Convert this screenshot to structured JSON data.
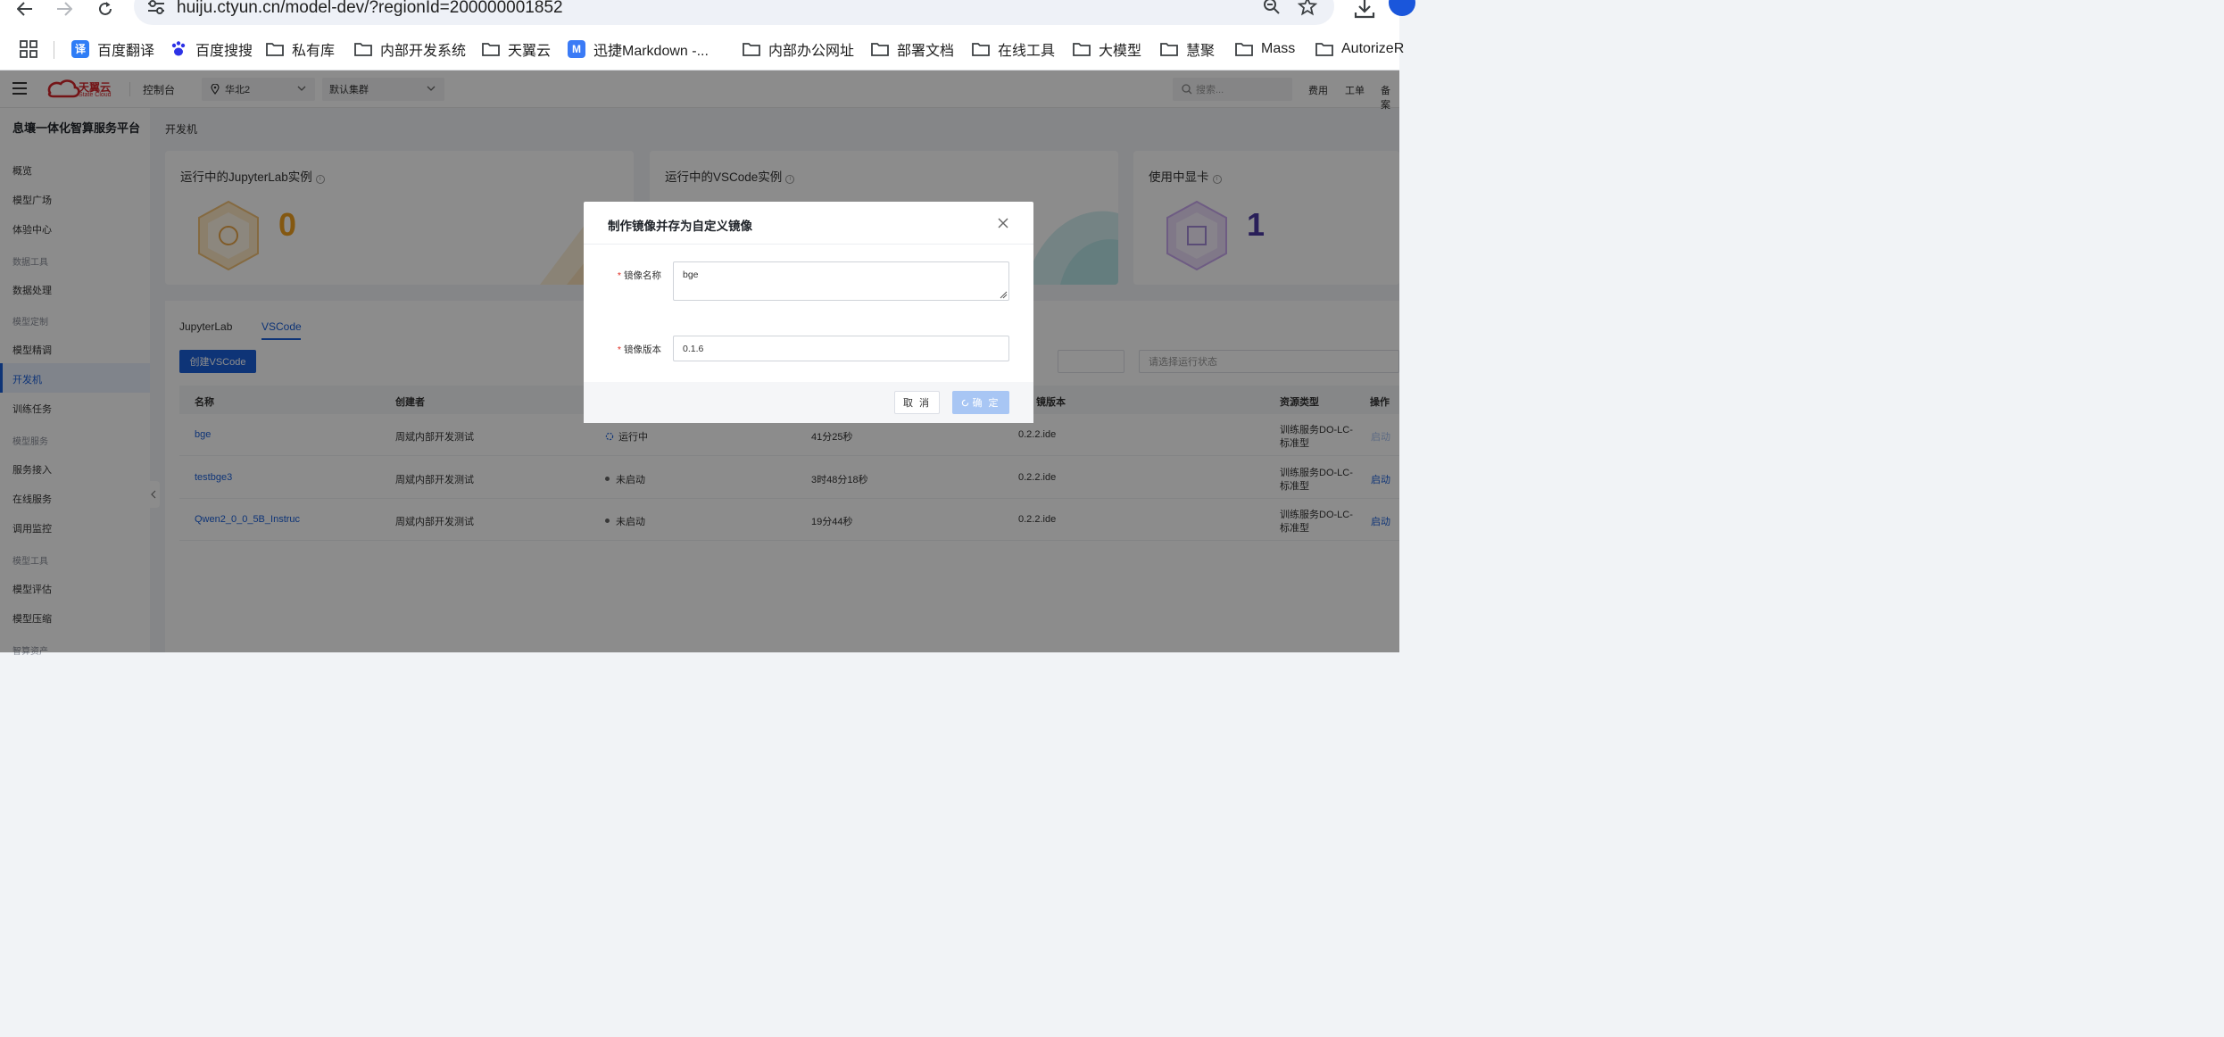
{
  "browser": {
    "url": "huiju.ctyun.cn/model-dev/?regionId=200000001852",
    "bookmarks": [
      {
        "label": "百度翻译",
        "icon": "translate-icon"
      },
      {
        "label": "百度搜搜",
        "icon": "baidu-paw-icon"
      },
      {
        "label": "私有库",
        "icon": "folder-icon"
      },
      {
        "label": "内部开发系统",
        "icon": "folder-icon"
      },
      {
        "label": "天翼云",
        "icon": "folder-icon"
      },
      {
        "label": "迅捷Markdown -...",
        "icon": "markdown-app-icon"
      },
      {
        "label": "内部办公网址",
        "icon": "folder-icon"
      },
      {
        "label": "部署文档",
        "icon": "folder-icon"
      },
      {
        "label": "在线工具",
        "icon": "folder-icon"
      },
      {
        "label": "大模型",
        "icon": "folder-icon"
      },
      {
        "label": "慧聚",
        "icon": "folder-icon"
      },
      {
        "label": "Mass",
        "icon": "folder-icon"
      },
      {
        "label": "AutorizeR",
        "icon": "folder-icon"
      }
    ]
  },
  "topnav": {
    "logo_cn": "天翼云",
    "logo_en": "State Cloud",
    "console": "控制台",
    "region": "华北2",
    "cluster": "默认集群",
    "search_placeholder": "搜索...",
    "links": [
      "费用",
      "工单",
      "备案"
    ]
  },
  "sidebar": {
    "title": "息壤一体化智算服务平台",
    "items": [
      {
        "type": "item",
        "label": "概览"
      },
      {
        "type": "item",
        "label": "模型广场"
      },
      {
        "type": "item",
        "label": "体验中心"
      },
      {
        "type": "group",
        "label": "数据工具"
      },
      {
        "type": "item",
        "label": "数据处理"
      },
      {
        "type": "group",
        "label": "模型定制"
      },
      {
        "type": "item",
        "label": "模型精调"
      },
      {
        "type": "active",
        "label": "开发机"
      },
      {
        "type": "item",
        "label": "训练任务"
      },
      {
        "type": "group",
        "label": "模型服务"
      },
      {
        "type": "item",
        "label": "服务接入"
      },
      {
        "type": "item",
        "label": "在线服务"
      },
      {
        "type": "item",
        "label": "调用监控"
      },
      {
        "type": "group",
        "label": "模型工具"
      },
      {
        "type": "item",
        "label": "模型评估"
      },
      {
        "type": "item",
        "label": "模型压缩"
      },
      {
        "type": "group",
        "label": "智算资产"
      }
    ]
  },
  "page": {
    "title": "开发机",
    "cards": [
      {
        "title": "运行中的JupyterLab实例",
        "value": "0",
        "color": "#f0a020"
      },
      {
        "title": "运行中的VSCode实例",
        "value": "",
        "color": "#1a5fd9"
      },
      {
        "title": "使用中显卡",
        "value": "1",
        "color": "#5b3fc4"
      }
    ],
    "tabs": [
      "JupyterLab",
      "VSCode"
    ],
    "active_tab": "VSCode",
    "create_button": "创建VSCode",
    "status_filter_placeholder": "请选择运行状态",
    "columns": [
      "名称",
      "创建者",
      "",
      "",
      "镜版本",
      "资源类型",
      "操作"
    ],
    "rows": [
      {
        "name": "bge",
        "creator": "周斌内部开发测试",
        "status": "运行中",
        "duration": "41分25秒",
        "version": "0.2.2.ide",
        "resource": [
          "训练服务DO-LC-",
          "标准型"
        ],
        "action": "启动",
        "action_disabled": true,
        "running": true
      },
      {
        "name": "testbge3",
        "creator": "周斌内部开发测试",
        "status": "未启动",
        "duration": "3时48分18秒",
        "version": "0.2.2.ide",
        "resource": [
          "训练服务DO-LC-",
          "标准型"
        ],
        "action": "启动",
        "action_disabled": false,
        "running": false
      },
      {
        "name": "Qwen2_0_0_5B_Instruc",
        "creator": "周斌内部开发测试",
        "status": "未启动",
        "duration": "19分44秒",
        "version": "0.2.2.ide",
        "resource": [
          "训练服务DO-LC-",
          "标准型"
        ],
        "action": "启动",
        "action_disabled": false,
        "running": false
      }
    ]
  },
  "modal": {
    "title": "制作镜像并存为自定义镜像",
    "image_name_label": "镜像名称",
    "image_name_value": "bge",
    "image_version_label": "镜像版本",
    "image_version_value": "0.1.6",
    "cancel": "取 消",
    "confirm": "确 定"
  }
}
